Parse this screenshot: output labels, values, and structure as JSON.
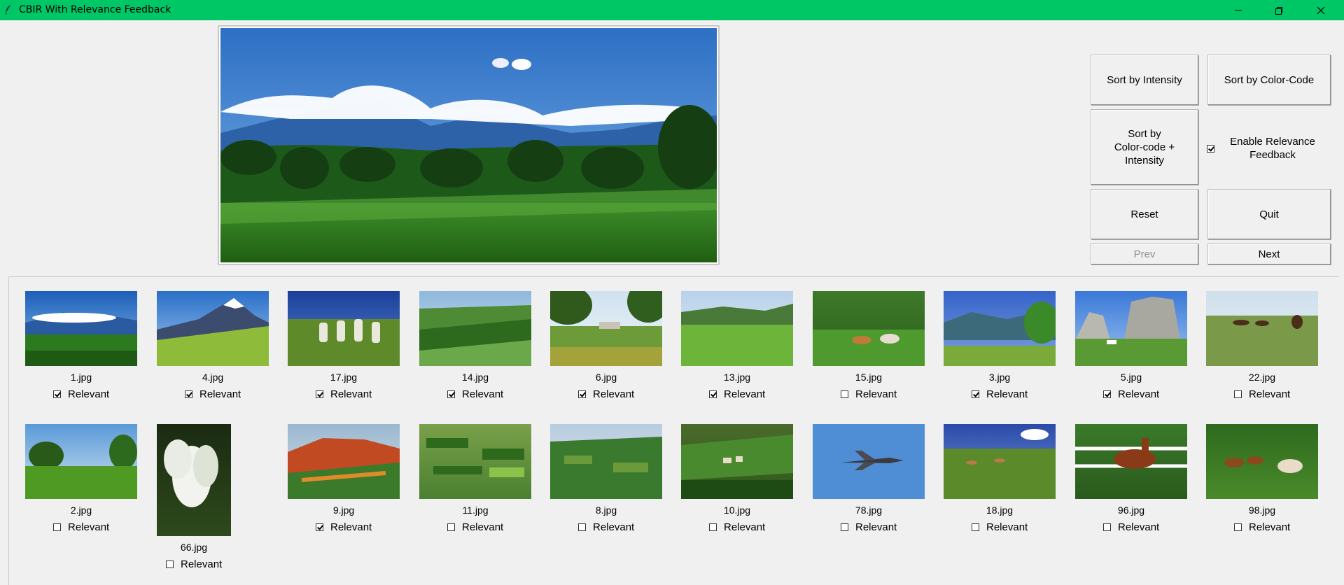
{
  "window": {
    "title": "CBIR With Relevance Feedback"
  },
  "buttons": {
    "sort_intensity": "Sort by Intensity",
    "sort_color": "Sort by Color-Code",
    "sort_combined": [
      "Sort by",
      "Color-code +",
      "Intensity"
    ],
    "enable_relevance": [
      "Enable Relevance",
      "Feedback"
    ],
    "reset": "Reset",
    "quit": "Quit",
    "prev": "Prev",
    "next": "Next"
  },
  "enable_relevance_checked": true,
  "relevant_label": "Relevant",
  "results": [
    {
      "file": "1.jpg",
      "relevant": true,
      "scene": "mountain-sky"
    },
    {
      "file": "4.jpg",
      "relevant": true,
      "scene": "snow-mountain"
    },
    {
      "file": "17.jpg",
      "relevant": true,
      "scene": "stones-field"
    },
    {
      "file": "14.jpg",
      "relevant": true,
      "scene": "fields"
    },
    {
      "file": "6.jpg",
      "relevant": true,
      "scene": "garden"
    },
    {
      "file": "13.jpg",
      "relevant": true,
      "scene": "meadow"
    },
    {
      "file": "15.jpg",
      "relevant": false,
      "scene": "horses-green"
    },
    {
      "file": "3.jpg",
      "relevant": true,
      "scene": "hills"
    },
    {
      "file": "5.jpg",
      "relevant": true,
      "scene": "cliff"
    },
    {
      "file": "22.jpg",
      "relevant": false,
      "scene": "horses-field"
    },
    {
      "file": "2.jpg",
      "relevant": false,
      "scene": "tropical"
    },
    {
      "file": "66.jpg",
      "relevant": false,
      "scene": "lily"
    },
    {
      "file": "9.jpg",
      "relevant": true,
      "scene": "red-hills"
    },
    {
      "file": "11.jpg",
      "relevant": false,
      "scene": "patchwork"
    },
    {
      "file": "8.jpg",
      "relevant": false,
      "scene": "valley"
    },
    {
      "file": "10.jpg",
      "relevant": false,
      "scene": "village"
    },
    {
      "file": "78.jpg",
      "relevant": false,
      "scene": "jet"
    },
    {
      "file": "18.jpg",
      "relevant": false,
      "scene": "horses-meadow"
    },
    {
      "file": "96.jpg",
      "relevant": false,
      "scene": "horse-fence"
    },
    {
      "file": "98.jpg",
      "relevant": false,
      "scene": "horses-trees"
    }
  ]
}
